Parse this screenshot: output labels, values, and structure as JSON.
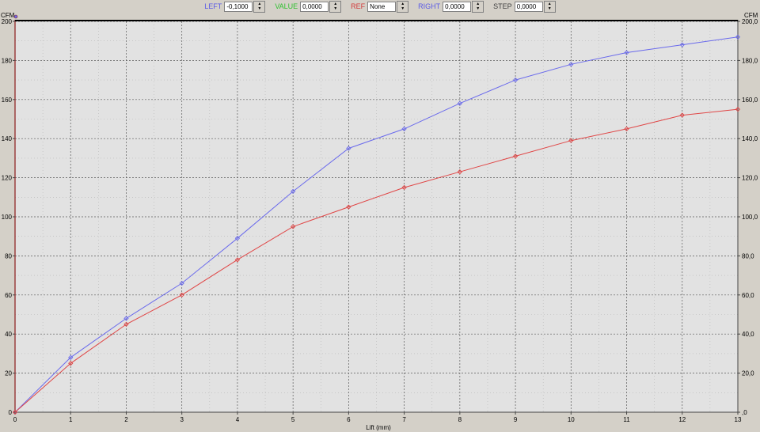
{
  "toolbar": {
    "left": {
      "label": "LEFT",
      "value": "-0,1000",
      "color": "#5a5ae6"
    },
    "value": {
      "label": "VALUE",
      "value": "0,0000",
      "color": "#2fc02f"
    },
    "ref": {
      "label": "REF",
      "value": "None",
      "color": "#d23c3c"
    },
    "right": {
      "label": "RIGHT",
      "value": "0,0000",
      "color": "#5a5ae6"
    },
    "step": {
      "label": "STEP",
      "value": "0,0000",
      "color": "#404040"
    }
  },
  "chart_data": {
    "type": "line",
    "xlabel": "Lift (mm)",
    "ylabel_left": "CFM",
    "ylabel_right": "CFM",
    "xlim": [
      0,
      13
    ],
    "ylim": [
      0,
      200
    ],
    "x_ticks": [
      "0",
      "1",
      "2",
      "3",
      "4",
      "5",
      "6",
      "7",
      "8",
      "9",
      "10",
      "11",
      "12",
      "13"
    ],
    "y_ticks_left": [
      "0",
      "20",
      "40",
      "60",
      "80",
      "100",
      "120",
      "140",
      "160",
      "180",
      "200"
    ],
    "y_ticks_right": [
      ",0",
      "20,0",
      "40,0",
      "60,0",
      "80,0",
      "100,0",
      "120,0",
      "140,0",
      "160,0",
      "180,0",
      "200,0"
    ],
    "grid": true,
    "background": "#e2e2e2",
    "x": [
      0,
      1,
      2,
      3,
      4,
      5,
      6,
      7,
      8,
      9,
      10,
      11,
      12,
      13
    ],
    "series": [
      {
        "color": "#6a6aec",
        "values": [
          0,
          28,
          48,
          66,
          89,
          113,
          135,
          145,
          158,
          170,
          178,
          184,
          188,
          192
        ]
      },
      {
        "color": "#e04646",
        "values": [
          0,
          25,
          45,
          60,
          78,
          95,
          105,
          115,
          123,
          131,
          139,
          145,
          152,
          155
        ]
      }
    ]
  }
}
